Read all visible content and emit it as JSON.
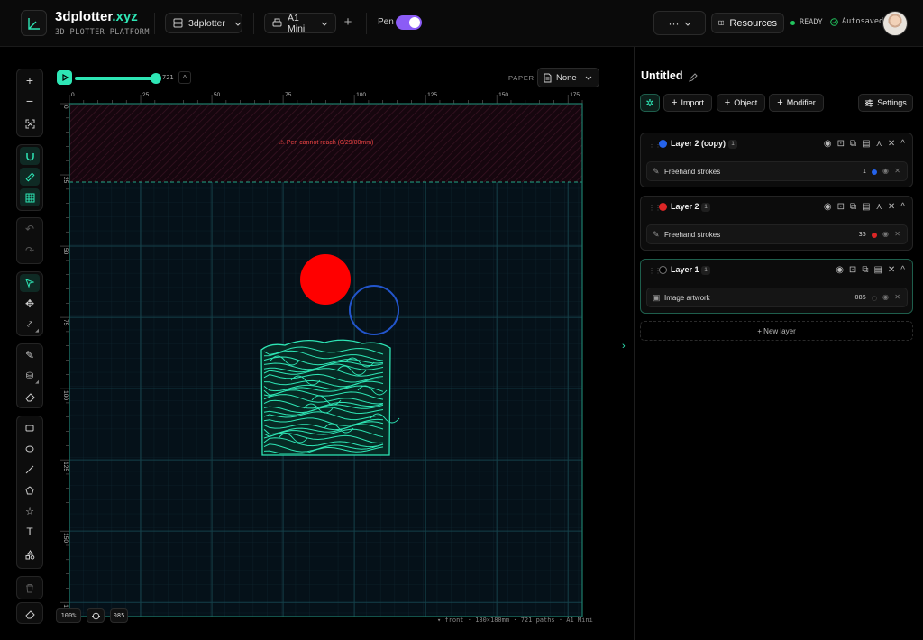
{
  "header": {
    "brand_name": "3dplotter",
    "brand_tld": ".xyz",
    "brand_subtitle": "3D PLOTTER PLATFORM",
    "workspace": "3dplotter",
    "machine": "A1 Mini",
    "pen_label": "Pen",
    "pen_enabled": true,
    "more_label": "···",
    "resources_label": "Resources",
    "status": "READY",
    "autosave": "Autosaved"
  },
  "toolbar": {
    "groups": [
      [
        "plus-icon",
        "minus-icon",
        "fit-icon"
      ],
      [
        "magnet-icon",
        "ruler-icon",
        "grid-icon"
      ],
      [
        "undo-icon",
        "redo-icon"
      ],
      [
        "select-icon",
        "move-icon",
        "node-icon"
      ],
      [
        "pen-icon",
        "fill-icon",
        "eraser-icon"
      ],
      [
        "rect-icon",
        "ellipse-icon",
        "line-icon",
        "pentagon-icon",
        "star-icon",
        "text-icon",
        "shapes-icon"
      ],
      [
        "trash-icon"
      ],
      [
        "clear-icon"
      ]
    ]
  },
  "canvas": {
    "path_slider_value": "721",
    "path_slider_fraction": 1.0,
    "paper_label": "PAPER",
    "paper_value": "None",
    "ruler_x": [
      "0",
      "25",
      "50",
      "75",
      "100",
      "125",
      "150",
      "175"
    ],
    "ruler_y": [
      "0",
      "25",
      "50",
      "75",
      "100",
      "125",
      "150",
      "175"
    ],
    "warning": "⚠ Pen cannot reach (0/29/00mm)",
    "zoom": "100%",
    "chip_label": "085",
    "status_line": "▾ front · 180×180mm · 721 paths · A1 Mini",
    "colors": {
      "accent": "#2ee6b5",
      "red_circle": "#ff0000",
      "blue_circle": "#2255cc",
      "grid_bg": "#051119",
      "no_reach": "#1c0a12"
    }
  },
  "panel": {
    "title": "Untitled",
    "buttons": {
      "import": "Import",
      "object": "Object",
      "modifier": "Modifier",
      "settings": "Settings"
    },
    "layers": [
      {
        "name": "Layer 2 (copy)",
        "count": "1",
        "color": "#2563eb",
        "row_icon": "pencil-icon",
        "row_name": "Freehand strokes",
        "row_count": "1",
        "row_color": "#2563eb"
      },
      {
        "name": "Layer 2",
        "count": "1",
        "color": "#dc2626",
        "row_icon": "pencil-icon",
        "row_name": "Freehand strokes",
        "row_count": "35",
        "row_color": "#dc2626"
      },
      {
        "name": "Layer 1",
        "count": "1",
        "color": "#000000",
        "row_icon": "image-icon",
        "row_name": "Image artwork",
        "row_count": "085",
        "row_color": "#111111"
      }
    ],
    "new_layer": "+ New layer"
  }
}
